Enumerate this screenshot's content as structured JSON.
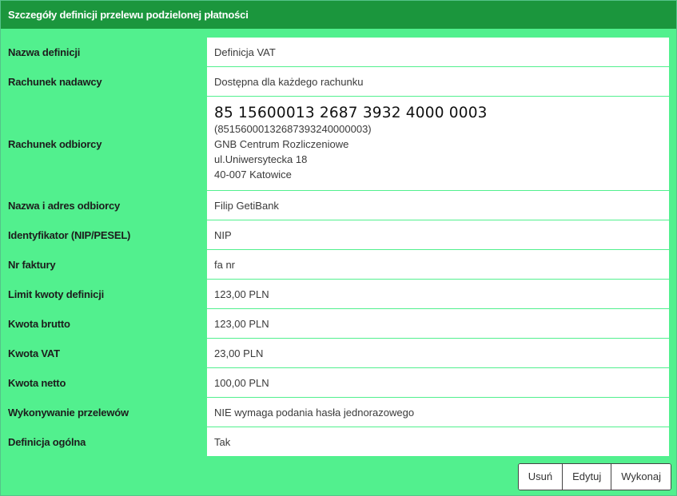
{
  "panel": {
    "title": "Szczegóły definicji przelewu podzielonej płatności"
  },
  "rows": [
    {
      "label": "Nazwa definicji",
      "value": "Definicja VAT"
    },
    {
      "label": "Rachunek nadawcy",
      "value": "Dostępna dla każdego rachunku"
    },
    {
      "label": "Rachunek odbiorcy",
      "account_formatted": "85 15600013 2687 3932 4000 0003",
      "account_raw": "(85156000132687393240000003)",
      "bank_name": "GNB Centrum Rozliczeniowe",
      "bank_street": "ul.Uniwersytecka 18",
      "bank_city": "40-007 Katowice"
    },
    {
      "label": "Nazwa i adres odbiorcy",
      "value": "Filip GetiBank"
    },
    {
      "label": "Identyfikator (NIP/PESEL)",
      "value": "NIP"
    },
    {
      "label": "Nr faktury",
      "value": "fa nr"
    },
    {
      "label": "Limit kwoty definicji",
      "value": "123,00 PLN"
    },
    {
      "label": "Kwota brutto",
      "value": "123,00 PLN"
    },
    {
      "label": "Kwota VAT",
      "value": "23,00 PLN"
    },
    {
      "label": "Kwota netto",
      "value": "100,00 PLN"
    },
    {
      "label": "Wykonywanie przelewów",
      "value": "NIE wymaga podania hasła jednorazowego"
    },
    {
      "label": "Definicja ogólna",
      "value": "Tak"
    }
  ],
  "actions": {
    "delete": "Usuń",
    "edit": "Edytuj",
    "execute": "Wykonaj"
  },
  "colors": {
    "header_bg": "#1b963d",
    "panel_bg": "#52f08e",
    "header_text": "#ffffff"
  }
}
